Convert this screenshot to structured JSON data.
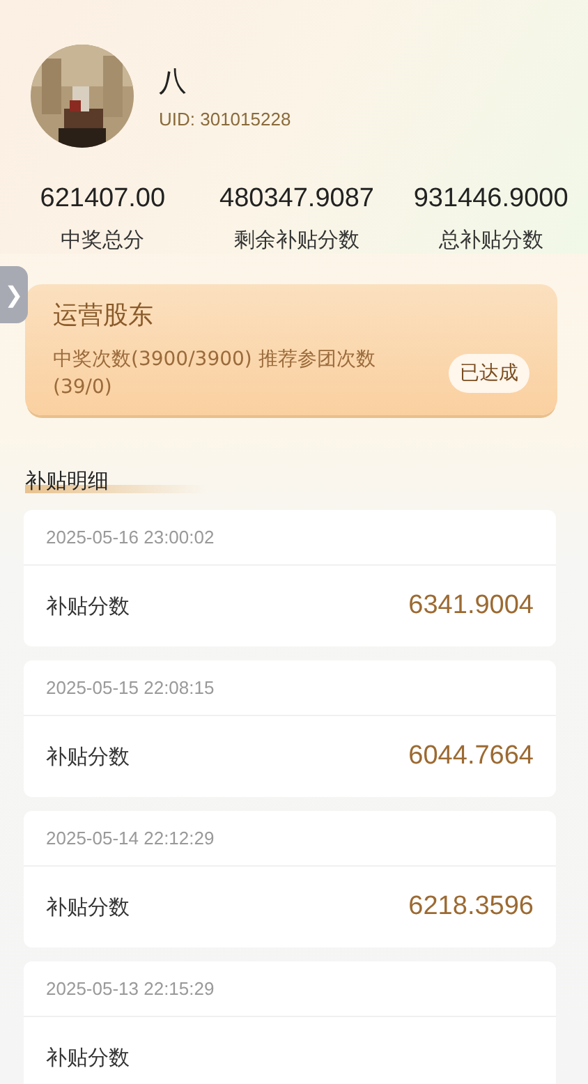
{
  "profile": {
    "name": "八",
    "uid": "UID: 301015228"
  },
  "stats": [
    {
      "value": "621407.00",
      "label": "中奖总分"
    },
    {
      "value": "480347.9087",
      "label": "剩余补贴分数"
    },
    {
      "value": "931446.9000",
      "label": "总补贴分数"
    }
  ],
  "side_tab": {
    "glyph": "❯"
  },
  "level_card": {
    "title": "运营股东",
    "progress": "中奖次数(3900/3900) 推荐参团次数(39/0)",
    "status": "已达成"
  },
  "section_title": "补贴明细",
  "records": [
    {
      "time": "2025-05-16 23:00:02",
      "label": "补贴分数",
      "value": "6341.9004"
    },
    {
      "time": "2025-05-15 22:08:15",
      "label": "补贴分数",
      "value": "6044.7664"
    },
    {
      "time": "2025-05-14 22:12:29",
      "label": "补贴分数",
      "value": "6218.3596"
    },
    {
      "time": "2025-05-13 22:15:29",
      "label": "补贴分数"
    }
  ]
}
